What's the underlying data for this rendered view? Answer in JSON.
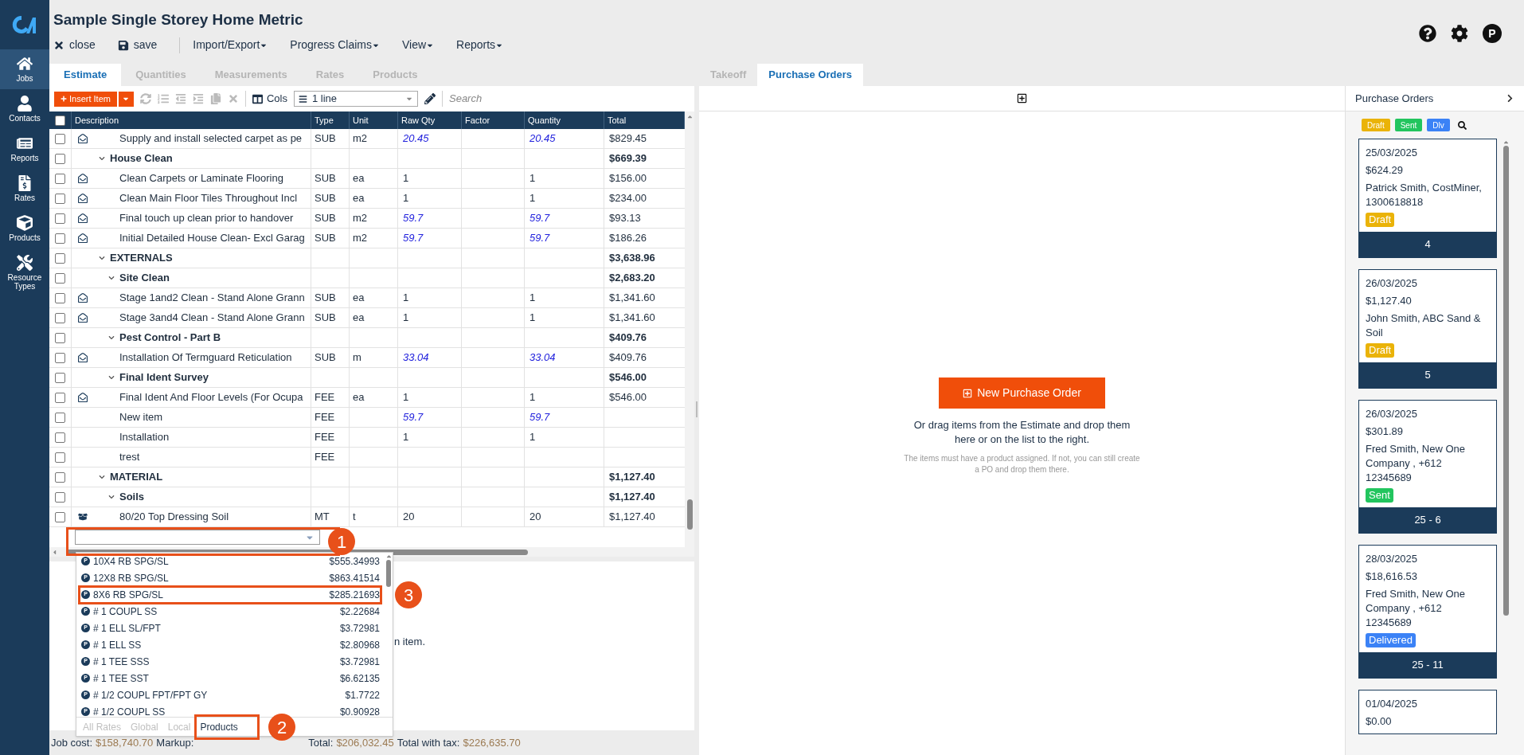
{
  "sidebar": {
    "items": [
      {
        "label": "Jobs",
        "kind": "home",
        "selected": true
      },
      {
        "label": "Contacts",
        "kind": "user",
        "selected": false
      },
      {
        "label": "Reports",
        "kind": "reports",
        "selected": false
      },
      {
        "label": "Rates",
        "kind": "rates",
        "selected": false
      },
      {
        "label": "Products",
        "kind": "products",
        "selected": false
      },
      {
        "label": "Resource Types",
        "kind": "tools",
        "selected": false
      }
    ]
  },
  "header": {
    "title": "Sample Single Storey Home Metric",
    "avatar": "P",
    "menu": [
      {
        "label": "close",
        "kind": "close"
      },
      {
        "label": "save",
        "kind": "save"
      },
      {
        "label": "Import/Export",
        "kind": "dropdown"
      },
      {
        "label": "Progress Claims",
        "kind": "dropdown"
      },
      {
        "label": "View",
        "kind": "dropdown"
      },
      {
        "label": "Reports",
        "kind": "dropdown"
      }
    ]
  },
  "estimate_tabs": [
    {
      "label": "Estimate",
      "selected": true
    },
    {
      "label": "Quantities",
      "selected": false
    },
    {
      "label": "Measurements",
      "selected": false
    },
    {
      "label": "Rates",
      "selected": false
    },
    {
      "label": "Products",
      "selected": false
    }
  ],
  "toolbar": {
    "insert_button": "Insert Item",
    "cols_button": "Cols",
    "lines_select": "1 line",
    "search": {
      "placeholder": "Search"
    }
  },
  "table": {
    "header_checked": false,
    "columns": [
      "Description",
      "Type",
      "Unit",
      "Raw Qty",
      "Factor",
      "Quantity",
      "Total"
    ],
    "rows": [
      {
        "kind": "item",
        "description": "Supply and install selected carpet as pe",
        "type": "SUB",
        "unit": "m2",
        "raw_qty": "20.45",
        "quantity": "20.45",
        "total": "$829.45",
        "from_takeoff": true,
        "checked": false
      },
      {
        "kind": "group",
        "description": "House Clean",
        "total": "$669.39",
        "expanded": true,
        "checked": false,
        "children": [
          {
            "kind": "item",
            "description": "Clean Carpets or Laminate Flooring",
            "type": "SUB",
            "unit": "ea",
            "raw_qty": "1",
            "quantity": "1",
            "total": "$156.00",
            "from_takeoff": false,
            "checked": false
          },
          {
            "kind": "item",
            "description": "Clean Main Floor Tiles Throughout Incl",
            "type": "SUB",
            "unit": "ea",
            "raw_qty": "1",
            "quantity": "1",
            "total": "$234.00",
            "from_takeoff": false,
            "checked": false
          },
          {
            "kind": "item",
            "description": "Final touch up clean prior to handover",
            "type": "SUB",
            "unit": "m2",
            "raw_qty": "59.7",
            "quantity": "59.7",
            "total": "$93.13",
            "from_takeoff": true,
            "checked": false
          },
          {
            "kind": "item",
            "description": "Initial Detailed House Clean- Excl Garag",
            "type": "SUB",
            "unit": "m2",
            "raw_qty": "59.7",
            "quantity": "59.7",
            "total": "$186.26",
            "from_takeoff": true,
            "checked": false
          }
        ]
      },
      {
        "kind": "group",
        "description": "EXTERNALS",
        "total": "$3,638.96",
        "expanded": true,
        "checked": false,
        "children": [
          {
            "kind": "group",
            "description": "Site Clean",
            "total": "$2,683.20",
            "expanded": true,
            "checked": false,
            "children": [
              {
                "kind": "item",
                "description": "Stage 1and2 Clean - Stand Alone Grann",
                "type": "SUB",
                "unit": "ea",
                "raw_qty": "1",
                "quantity": "1",
                "total": "$1,341.60",
                "from_takeoff": false,
                "checked": false
              },
              {
                "kind": "item",
                "description": "Stage 3and4 Clean - Stand Alone Grann",
                "type": "SUB",
                "unit": "ea",
                "raw_qty": "1",
                "quantity": "1",
                "total": "$1,341.60",
                "from_takeoff": false,
                "checked": false
              }
            ]
          },
          {
            "kind": "group",
            "description": "Pest Control - Part B",
            "total": "$409.76",
            "expanded": true,
            "checked": false,
            "children": [
              {
                "kind": "item",
                "description": "Installation Of Termguard Reticulation",
                "type": "SUB",
                "unit": "m",
                "raw_qty": "33.04",
                "quantity": "33.04",
                "total": "$409.76",
                "from_takeoff": true,
                "checked": false
              }
            ]
          },
          {
            "kind": "group",
            "description": "Final Ident Survey",
            "total": "$546.00",
            "expanded": true,
            "checked": false,
            "children": [
              {
                "kind": "item",
                "description": "Final Ident And Floor Levels (For Ocupa",
                "type": "FEE",
                "unit": "ea",
                "raw_qty": "1",
                "quantity": "1",
                "total": "$546.00",
                "from_takeoff": false,
                "checked": false
              },
              {
                "kind": "plain",
                "description": "New item",
                "type": "FEE",
                "raw_qty": "59.7",
                "quantity": "59.7",
                "from_takeoff": true,
                "checked": false
              },
              {
                "kind": "plain",
                "description": "Installation",
                "type": "FEE",
                "raw_qty": "1",
                "quantity": "1",
                "from_takeoff": false,
                "checked": false
              },
              {
                "kind": "plain",
                "description": "trest",
                "type": "FEE",
                "checked": false
              }
            ]
          }
        ]
      },
      {
        "kind": "group",
        "description": "MATERIAL",
        "total": "$1,127.40",
        "expanded": true,
        "checked": false,
        "children": [
          {
            "kind": "group",
            "description": "Soils",
            "total": "$1,127.40",
            "expanded": true,
            "checked": false,
            "children": [
              {
                "kind": "product",
                "description": "80/20 Top Dressing Soil",
                "type": "MT",
                "unit": "t",
                "raw_qty": "20",
                "quantity": "20",
                "total": "$1,127.40",
                "from_takeoff": false,
                "checked": false
              }
            ]
          }
        ]
      }
    ]
  },
  "product_dropdown": {
    "options": [
      {
        "badge": "P",
        "name": "10X4 RB SPG/SL",
        "price": "$555.34993"
      },
      {
        "badge": "P",
        "name": "12X8 RB SPG/SL",
        "price": "$863.41514"
      },
      {
        "badge": "P",
        "name": "8X6 RB SPG/SL",
        "price": "$285.21693"
      },
      {
        "badge": "P",
        "name": "# 1 COUPL SS",
        "price": "$2.22684"
      },
      {
        "badge": "P",
        "name": "# 1 ELL SL/FPT",
        "price": "$3.72981"
      },
      {
        "badge": "P",
        "name": "# 1 ELL SS",
        "price": "$2.80968"
      },
      {
        "badge": "P",
        "name": "# 1 TEE SSS",
        "price": "$3.72981"
      },
      {
        "badge": "P",
        "name": "# 1 TEE SST",
        "price": "$6.62135"
      },
      {
        "badge": "P",
        "name": "# 1/2 COUPL FPT/FPT GY",
        "price": "$1.7722"
      },
      {
        "badge": "P",
        "name": "# 1/2 COUPL SS",
        "price": "$0.90928"
      }
    ],
    "tabs": [
      {
        "label": "All Rates",
        "selected": false
      },
      {
        "label": "Global",
        "selected": false
      },
      {
        "label": "Local",
        "selected": false
      },
      {
        "label": "Products",
        "selected": true
      }
    ]
  },
  "detail_panel": {
    "text": "n item."
  },
  "footer": [
    {
      "label": "Job cost:",
      "value": "$158,740.70"
    },
    {
      "label": "Markup:"
    },
    {
      "label": "Total:",
      "value": "$206,032.45"
    },
    {
      "label": "Total with tax:",
      "value": "$226,635.70"
    }
  ],
  "right_tabs": [
    {
      "label": "Takeoff",
      "selected": false
    },
    {
      "label": "Purchase Orders",
      "selected": true
    }
  ],
  "purchase_orders": {
    "new_button": "New Purchase Order",
    "hint": "Or drag items from the Estimate and drop them here or on the list to the right.",
    "note": "The items must have a product assigned. If not, you can still create a PO and drop them there."
  },
  "po_panel": {
    "title": "Purchase Orders",
    "filters": [
      {
        "label": "Draft",
        "color": "#eab308"
      },
      {
        "label": "Sent",
        "color": "#22c55e"
      },
      {
        "label": "Dlv",
        "color": "#3b82f6"
      }
    ],
    "cards": [
      {
        "date": "25/03/2025",
        "amount": "$624.29",
        "contact": "Patrick Smith, CostMiner, 1300618818",
        "status": {
          "label": "Draft",
          "color": "#eab308"
        },
        "number": "4"
      },
      {
        "date": "26/03/2025",
        "amount": "$1,127.40",
        "contact": "John Smith, ABC Sand & Soil",
        "status": {
          "label": "Draft",
          "color": "#eab308"
        },
        "number": "5"
      },
      {
        "date": "26/03/2025",
        "amount": "$301.89",
        "contact": "Fred Smith, New One Company , +612 12345689",
        "status": {
          "label": "Sent",
          "color": "#22c55e"
        },
        "number": "25 - 6"
      },
      {
        "date": "28/03/2025",
        "amount": "$18,616.53",
        "contact": "Fred Smith, New One Company , +612 12345689",
        "status": {
          "label": "Delivered",
          "color": "#3b82f6"
        },
        "number": "25 - 11"
      },
      {
        "date": "01/04/2025",
        "amount": "$0.00"
      }
    ]
  },
  "annotations": [
    {
      "label": "1"
    },
    {
      "label": "2"
    },
    {
      "label": "3"
    }
  ]
}
